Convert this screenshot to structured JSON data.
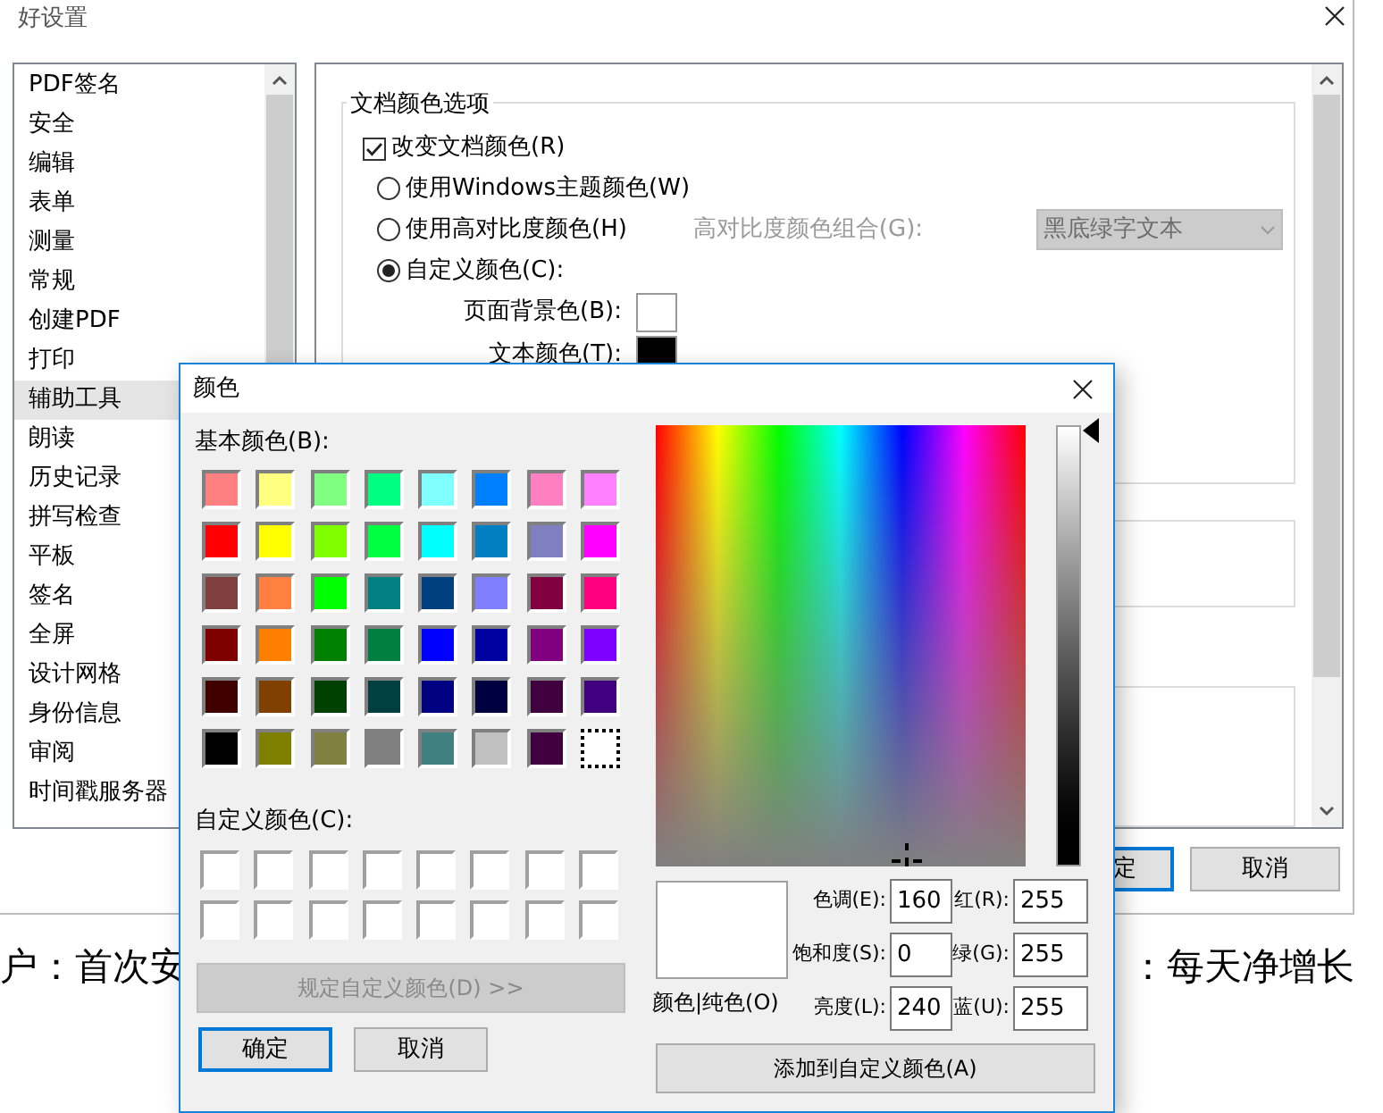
{
  "preferences_window": {
    "title": "好设置",
    "sidebar": {
      "items": [
        {
          "label": "PDF签名",
          "selected": false
        },
        {
          "label": "安全",
          "selected": false
        },
        {
          "label": "编辑",
          "selected": false
        },
        {
          "label": "表单",
          "selected": false
        },
        {
          "label": "测量",
          "selected": false
        },
        {
          "label": "常规",
          "selected": false
        },
        {
          "label": "创建PDF",
          "selected": false
        },
        {
          "label": "打印",
          "selected": false
        },
        {
          "label": "辅助工具",
          "selected": true
        },
        {
          "label": "朗读",
          "selected": false
        },
        {
          "label": "历史记录",
          "selected": false
        },
        {
          "label": "拼写检查",
          "selected": false
        },
        {
          "label": "平板",
          "selected": false
        },
        {
          "label": "签名",
          "selected": false
        },
        {
          "label": "全屏",
          "selected": false
        },
        {
          "label": "设计网格",
          "selected": false
        },
        {
          "label": "身份信息",
          "selected": false
        },
        {
          "label": "审阅",
          "selected": false
        },
        {
          "label": "时间戳服务器",
          "selected": false
        }
      ]
    },
    "document_colors": {
      "legend": "文档颜色选项",
      "change_colors": {
        "label": "改变文档颜色(R)",
        "checked": true
      },
      "options": [
        {
          "label": "使用Windows主题颜色(W)",
          "selected": false
        },
        {
          "label": "使用高对比度颜色(H)",
          "selected": false
        },
        {
          "label": "自定义颜色(C):",
          "selected": true
        }
      ],
      "high_contrast": {
        "label": "高对比度颜色组合(G):",
        "value": "黑底绿字文本",
        "disabled": true
      },
      "color_rows": [
        {
          "label": "页面背景色(B):",
          "color": "#ffffff"
        },
        {
          "label": "文本颜色(T):",
          "color": "#000000"
        }
      ]
    },
    "buttons": [
      {
        "label": "定",
        "default": true
      },
      {
        "label": "取消",
        "default": false
      }
    ]
  },
  "background_text": [
    "户：首次安",
    "：每天净增长"
  ],
  "color_dialog": {
    "title": "颜色",
    "basic_label": "基本颜色(B):",
    "basic_colors": [
      {
        "color": "#ff8080",
        "selected": false
      },
      {
        "color": "#ffff80",
        "selected": false
      },
      {
        "color": "#80ff80",
        "selected": false
      },
      {
        "color": "#00ff80",
        "selected": false
      },
      {
        "color": "#80ffff",
        "selected": false
      },
      {
        "color": "#0080ff",
        "selected": false
      },
      {
        "color": "#ff80c0",
        "selected": false
      },
      {
        "color": "#ff80ff",
        "selected": false
      },
      {
        "color": "#ff0000",
        "selected": false
      },
      {
        "color": "#ffff00",
        "selected": false
      },
      {
        "color": "#80ff00",
        "selected": false
      },
      {
        "color": "#00ff40",
        "selected": false
      },
      {
        "color": "#00ffff",
        "selected": false
      },
      {
        "color": "#0080c0",
        "selected": false
      },
      {
        "color": "#8080c0",
        "selected": false
      },
      {
        "color": "#ff00ff",
        "selected": false
      },
      {
        "color": "#804040",
        "selected": false
      },
      {
        "color": "#ff8040",
        "selected": false
      },
      {
        "color": "#00ff00",
        "selected": false
      },
      {
        "color": "#008080",
        "selected": false
      },
      {
        "color": "#004080",
        "selected": false
      },
      {
        "color": "#8080ff",
        "selected": false
      },
      {
        "color": "#800040",
        "selected": false
      },
      {
        "color": "#ff0080",
        "selected": false
      },
      {
        "color": "#800000",
        "selected": false
      },
      {
        "color": "#ff8000",
        "selected": false
      },
      {
        "color": "#008000",
        "selected": false
      },
      {
        "color": "#008040",
        "selected": false
      },
      {
        "color": "#0000ff",
        "selected": false
      },
      {
        "color": "#0000a0",
        "selected": false
      },
      {
        "color": "#800080",
        "selected": false
      },
      {
        "color": "#8000ff",
        "selected": false
      },
      {
        "color": "#400000",
        "selected": false
      },
      {
        "color": "#804000",
        "selected": false
      },
      {
        "color": "#004000",
        "selected": false
      },
      {
        "color": "#004040",
        "selected": false
      },
      {
        "color": "#000080",
        "selected": false
      },
      {
        "color": "#000040",
        "selected": false
      },
      {
        "color": "#400040",
        "selected": false
      },
      {
        "color": "#400080",
        "selected": false
      },
      {
        "color": "#000000",
        "selected": false
      },
      {
        "color": "#808000",
        "selected": false
      },
      {
        "color": "#808040",
        "selected": false
      },
      {
        "color": "#808080",
        "selected": false
      },
      {
        "color": "#408080",
        "selected": false
      },
      {
        "color": "#c0c0c0",
        "selected": false
      },
      {
        "color": "#400040",
        "selected": false
      },
      {
        "color": "#ffffff",
        "selected": true
      }
    ],
    "custom_label": "自定义颜色(C):",
    "custom_colors": [
      {
        "color": "#ffffff"
      },
      {
        "color": "#ffffff"
      },
      {
        "color": "#ffffff"
      },
      {
        "color": "#ffffff"
      },
      {
        "color": "#ffffff"
      },
      {
        "color": "#ffffff"
      },
      {
        "color": "#ffffff"
      },
      {
        "color": "#ffffff"
      },
      {
        "color": "#ffffff"
      },
      {
        "color": "#ffffff"
      },
      {
        "color": "#ffffff"
      },
      {
        "color": "#ffffff"
      },
      {
        "color": "#ffffff"
      },
      {
        "color": "#ffffff"
      },
      {
        "color": "#ffffff"
      },
      {
        "color": "#ffffff"
      }
    ],
    "define_button": {
      "label": "规定自定义颜色(D) >>",
      "disabled": true
    },
    "luminance": {
      "level": 1
    },
    "preview": {
      "color": "#ffffff",
      "label": "颜色|纯色(O)"
    },
    "fields": [
      {
        "label": "色调(E):",
        "value": "160"
      },
      {
        "label": "红(R):",
        "value": "255"
      },
      {
        "label": "饱和度(S):",
        "value": "0"
      },
      {
        "label": "绿(G):",
        "value": "255"
      },
      {
        "label": "亮度(L):",
        "value": "240"
      },
      {
        "label": "蓝(U):",
        "value": "255"
      }
    ],
    "buttons": [
      {
        "label": "确定",
        "default": true
      },
      {
        "label": "取消",
        "default": false
      }
    ],
    "add_button": {
      "label": "添加到自定义颜色(A)"
    }
  }
}
